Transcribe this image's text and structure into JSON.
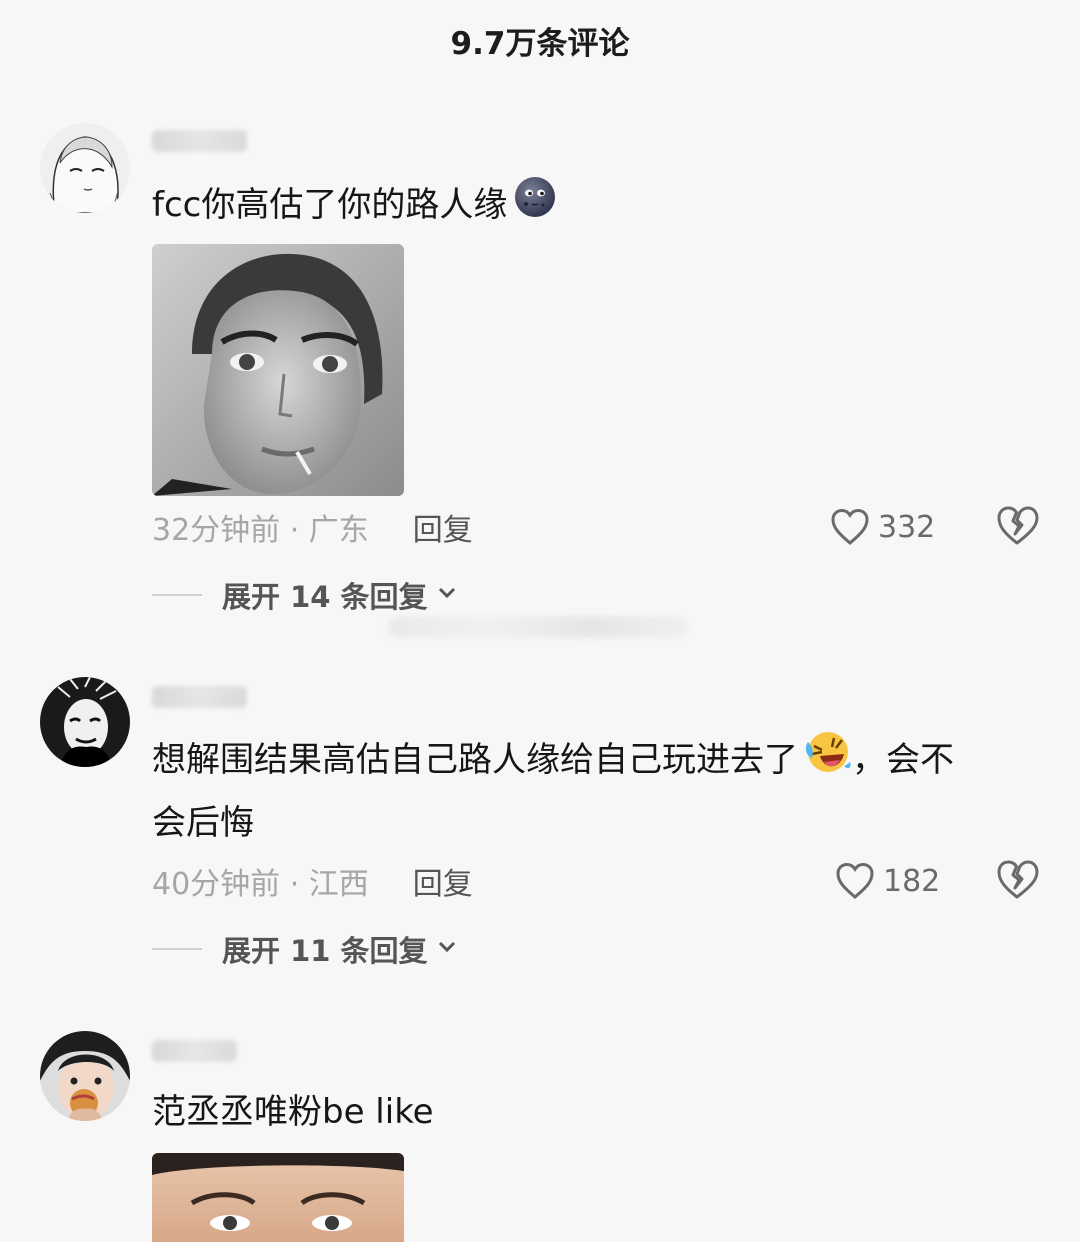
{
  "header": {
    "title": "9.7万条评论"
  },
  "comments": [
    {
      "text": "fcc你高估了你的路人缘",
      "time": "32分钟前 · 广东",
      "reply_label": "回复",
      "likes": "332",
      "expand_label": "展开 14 条回复",
      "emoji": "new-moon-face-emoji"
    },
    {
      "text": "想解围结果高估自己路人缘给自己玩进去了",
      "text_tail": "，会不\n会后悔",
      "time": "40分钟前 · 江西",
      "reply_label": "回复",
      "likes": "182",
      "expand_label": "展开 11 条回复",
      "emoji": "rolling-laughing-emoji"
    },
    {
      "text": "范丞丞唯粉be like"
    }
  ]
}
